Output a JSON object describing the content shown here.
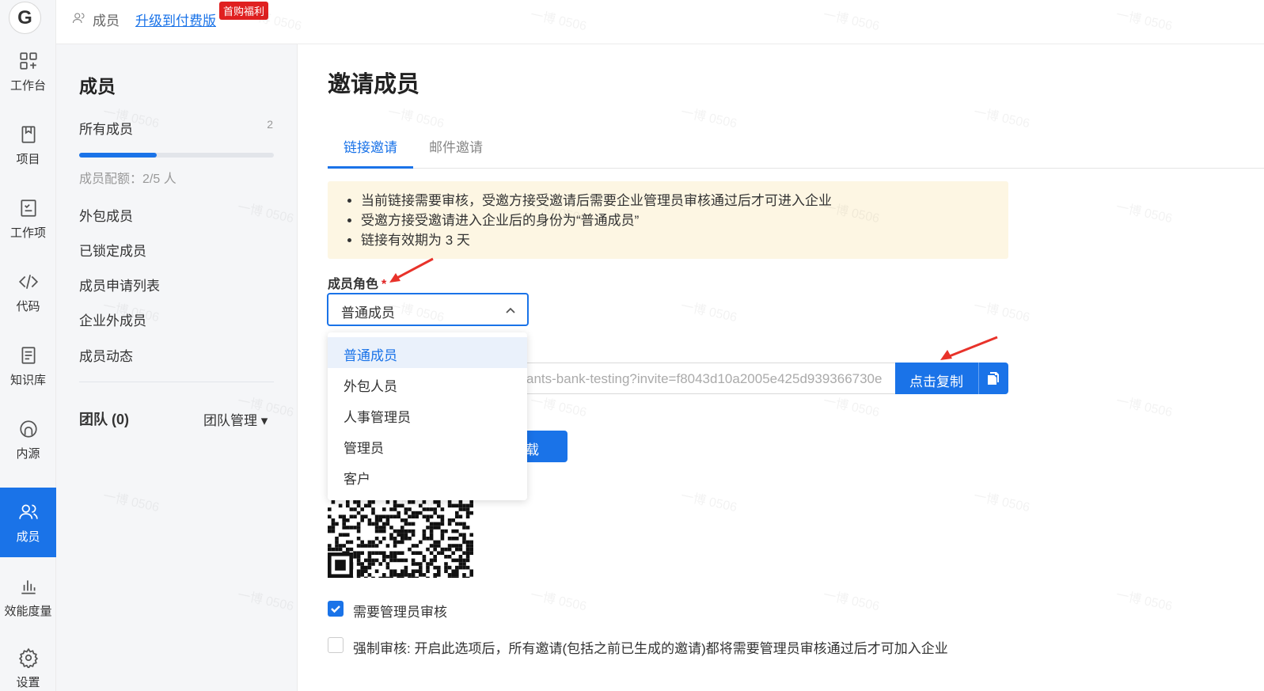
{
  "app": {
    "logo_letter": "G"
  },
  "rail": {
    "items": [
      {
        "label": "工作台",
        "icon": "dashboard-icon"
      },
      {
        "label": "项目",
        "icon": "project-icon"
      },
      {
        "label": "工作项",
        "icon": "tasks-icon"
      },
      {
        "label": "代码",
        "icon": "code-icon"
      },
      {
        "label": "知识库",
        "icon": "knowledge-icon"
      },
      {
        "label": "内源",
        "icon": "inner-source-icon"
      },
      {
        "label": "成员",
        "icon": "members-icon",
        "active": true
      },
      {
        "label": "效能度量",
        "icon": "metrics-icon"
      },
      {
        "label": "设置",
        "icon": "settings-icon"
      }
    ]
  },
  "header": {
    "breadcrumb": "成员",
    "upgrade_link": "升级到付费版",
    "promo_badge": "首购福利"
  },
  "sidebar": {
    "title": "成员",
    "all_members": {
      "label": "所有成员",
      "count": "2"
    },
    "quota": {
      "text": "成员配额：2/5 人",
      "used": 2,
      "total": 5,
      "fill_fraction": 0.4
    },
    "items": [
      "外包成员",
      "已锁定成员",
      "成员申请列表",
      "企业外成员",
      "成员动态"
    ],
    "team": {
      "label": "团队 (0)",
      "manage": "团队管理 ▾"
    }
  },
  "main": {
    "title": "邀请成员",
    "tabs": [
      {
        "label": "链接邀请",
        "active": true
      },
      {
        "label": "邮件邀请",
        "active": false
      }
    ],
    "notice": [
      "当前链接需要审核，受邀方接受邀请后需要企业管理员审核通过后才可进入企业",
      "受邀方接受邀请进入企业后的身份为“普通成员”",
      "链接有效期为 3 天"
    ],
    "role_field": {
      "label": "成员角色",
      "required_mark": "*",
      "value": "普通成员"
    },
    "role_options": [
      "普通成员",
      "外包人员",
      "人事管理员",
      "管理员",
      "客户"
    ],
    "invite_link": "ants-bank-testing?invite=f8043d10a2005e425d939366730e",
    "copy_button": "点击复制",
    "download_button": "下载",
    "download_button_visible": "载",
    "checkboxes": [
      {
        "label": "需要管理员审核",
        "checked": true
      },
      {
        "label": "强制审核: 开启此选项后，所有邀请(包括之前已生成的邀请)都将需要管理员审核通过后才可加入企业",
        "checked": false
      }
    ]
  },
  "watermark": "一博 0506",
  "colors": {
    "accent": "#1a73e8",
    "notice_bg": "#fdf6e3",
    "promo": "#e02020"
  }
}
